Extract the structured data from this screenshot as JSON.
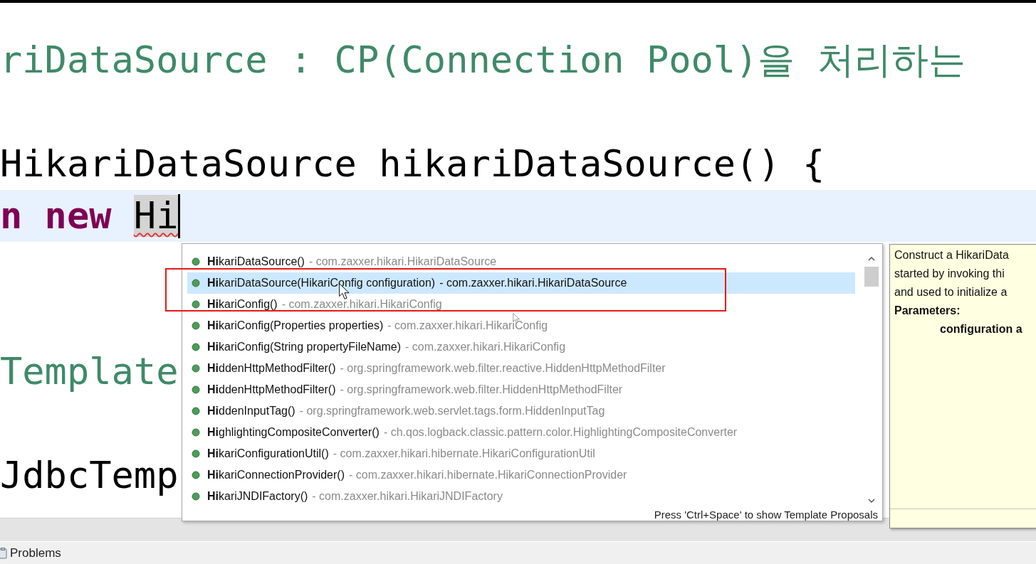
{
  "editor": {
    "lines": [
      {
        "tokens": [
          {
            "text": "riDataSource : CP(Connection Pool)을 처리하는",
            "kind": "comment"
          }
        ]
      },
      {
        "tokens": [
          {
            "text": "HikariDataSource hikariDataSource() {",
            "kind": "plain"
          }
        ]
      },
      {
        "current": true,
        "tokens": [
          {
            "text": "n new ",
            "kind": "keyword"
          },
          {
            "text": "Hi",
            "kind": "typed"
          }
        ]
      },
      {
        "tokens": [
          {
            "text": "Template",
            "kind": "comment"
          }
        ]
      },
      {
        "tokens": [
          {
            "text": "JdbcTemp",
            "kind": "plain"
          }
        ]
      }
    ]
  },
  "proposals": {
    "items": [
      {
        "label": "**Hi**kariDataSource()",
        "qualifier": "- com.zaxxer.hikari.HikariDataSource",
        "selected": false
      },
      {
        "label": "**Hi**kariDataSource(HikariConfig configuration)",
        "qualifier": "- com.zaxxer.hikari.HikariDataSource",
        "selected": true
      },
      {
        "label": "**Hi**kariConfig()",
        "qualifier": "- com.zaxxer.hikari.HikariConfig",
        "selected": false
      },
      {
        "label": "**Hi**kariConfig(Properties properties)",
        "qualifier": "- com.zaxxer.hikari.HikariConfig",
        "selected": false
      },
      {
        "label": "**Hi**kariConfig(String propertyFileName)",
        "qualifier": "- com.zaxxer.hikari.HikariConfig",
        "selected": false
      },
      {
        "label": "**Hi**ddenHttpMethodFilter()",
        "qualifier": "- org.springframework.web.filter.reactive.HiddenHttpMethodFilter",
        "selected": false
      },
      {
        "label": "**Hi**ddenHttpMethodFilter()",
        "qualifier": "- org.springframework.web.filter.HiddenHttpMethodFilter",
        "selected": false
      },
      {
        "label": "**Hi**ddenInputTag()",
        "qualifier": "- org.springframework.web.servlet.tags.form.HiddenInputTag",
        "selected": false
      },
      {
        "label": "**Hi**ghlightingCompositeConverter()",
        "qualifier": "- ch.qos.logback.classic.pattern.color.HighlightingCompositeConverter",
        "selected": false
      },
      {
        "label": "**Hi**kariConfigurationUtil()",
        "qualifier": "- com.zaxxer.hikari.hibernate.HikariConfigurationUtil",
        "selected": false
      },
      {
        "label": "**Hi**kariConnectionProvider()",
        "qualifier": "- com.zaxxer.hikari.hibernate.HikariConnectionProvider",
        "selected": false
      },
      {
        "label": "**Hi**kariJNDIFactory()",
        "qualifier": "- com.zaxxer.hikari.HikariJNDIFactory",
        "selected": false
      }
    ],
    "footer": "Press 'Ctrl+Space' to show Template Proposals"
  },
  "documentation": {
    "lines": [
      {
        "text": "Construct a HikariData",
        "kind": "text"
      },
      {
        "text": "started by invoking thi",
        "kind": "text"
      },
      {
        "text": "and used to initialize a",
        "kind": "text"
      },
      {
        "text": "Parameters:",
        "kind": "heading"
      },
      {
        "text": "configuration a",
        "kind": "param"
      }
    ]
  },
  "bottom_panel": {
    "tabs": [
      {
        "label": "Problems"
      }
    ]
  }
}
